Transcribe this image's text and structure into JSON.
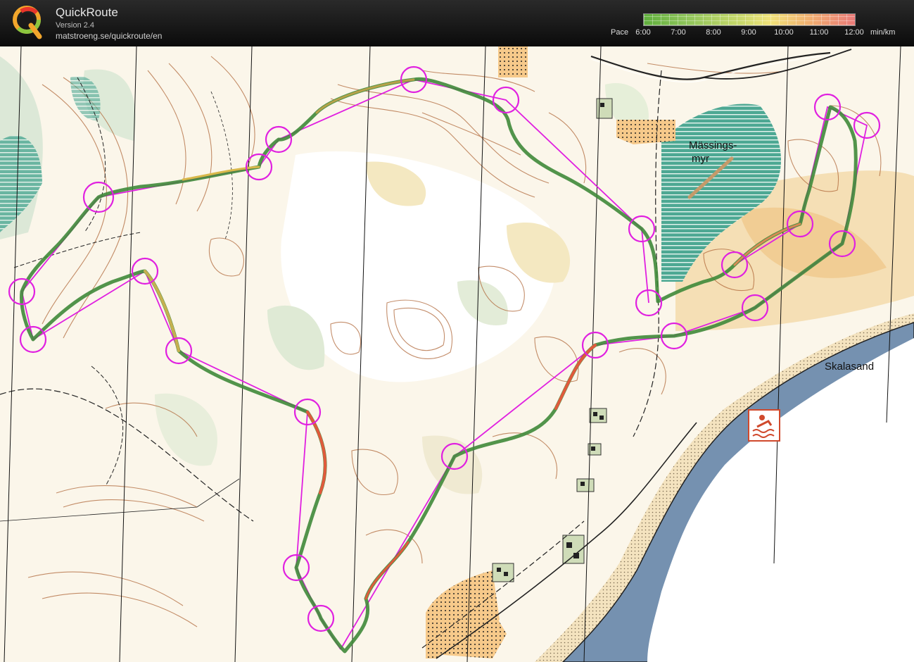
{
  "app": {
    "title": "QuickRoute",
    "version": "Version 2.4",
    "url": "matstroeng.se/quickroute/en"
  },
  "legend": {
    "label": "Pace",
    "ticks": [
      "6:00",
      "7:00",
      "8:00",
      "9:00",
      "10:00",
      "11:00",
      "12:00"
    ],
    "unit": "min/km",
    "colors": {
      "fast": "#5fae3c",
      "medium": "#f0e27a",
      "slow": "#ea7a78"
    }
  },
  "map": {
    "labels": {
      "marsh_line1": "Mässings-",
      "marsh_line2": "myr",
      "beach": "Skalasand"
    },
    "symbols": [
      "swimming-symbol"
    ],
    "colors": {
      "course": "#e020e0",
      "route_fast": "#3f8a3a",
      "route_slow": "#e05a3c",
      "water": "#7591b0",
      "contour": "#b0683a",
      "marsh": "#3c9e86"
    }
  }
}
